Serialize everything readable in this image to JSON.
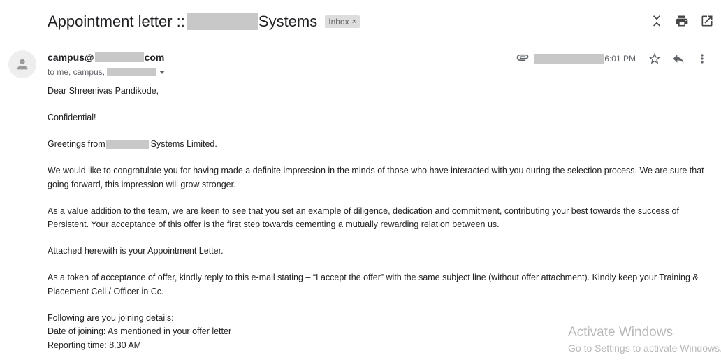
{
  "email": {
    "subject_prefix": "Appointment letter ::",
    "subject_suffix": "Systems",
    "label": "Inbox",
    "label_remove": "×",
    "sender_prefix": "campus@",
    "sender_suffix": "com",
    "to_text": "to me, campus,",
    "time": "6:01 PM"
  },
  "icons": {
    "top": [
      "collapse-all-icon",
      "print-icon",
      "open-new-window-icon"
    ],
    "meta": [
      "attachment-icon",
      "star-icon",
      "reply-icon",
      "more-vert-icon"
    ]
  },
  "body": {
    "salutation": "Dear Shreenivas Pandikode,",
    "confidential": "Confidential!",
    "greetings_prefix": "Greetings from",
    "greetings_suffix": "Systems Limited.",
    "para1": "We would like to congratulate you for having made a definite impression in the minds of those who have interacted with you during the selection process. We are sure that going forward, this impression will grow stronger.",
    "para2": "As a value addition to the team, we are keen to see that you set an example of diligence, dedication and commitment, contributing your best towards the success of Persistent. Your acceptance of this offer is the first step towards cementing a mutually rewarding relation between us.",
    "para3": "Attached herewith is your Appointment Letter.",
    "para4": "As a token of acceptance of offer, kindly reply to this e-mail stating – “I accept the offer” with the same subject line (without offer attachment). Kindly keep your Training & Placement Cell / Officer in Cc.",
    "details_heading": "Following are you joining details:",
    "date_of_joining": "Date of joining: As mentioned in your offer letter",
    "reporting_time": "Reporting time: 8.30 AM"
  },
  "watermark": {
    "line1": "Activate Windows",
    "line2": "Go to Settings to activate Windows."
  }
}
